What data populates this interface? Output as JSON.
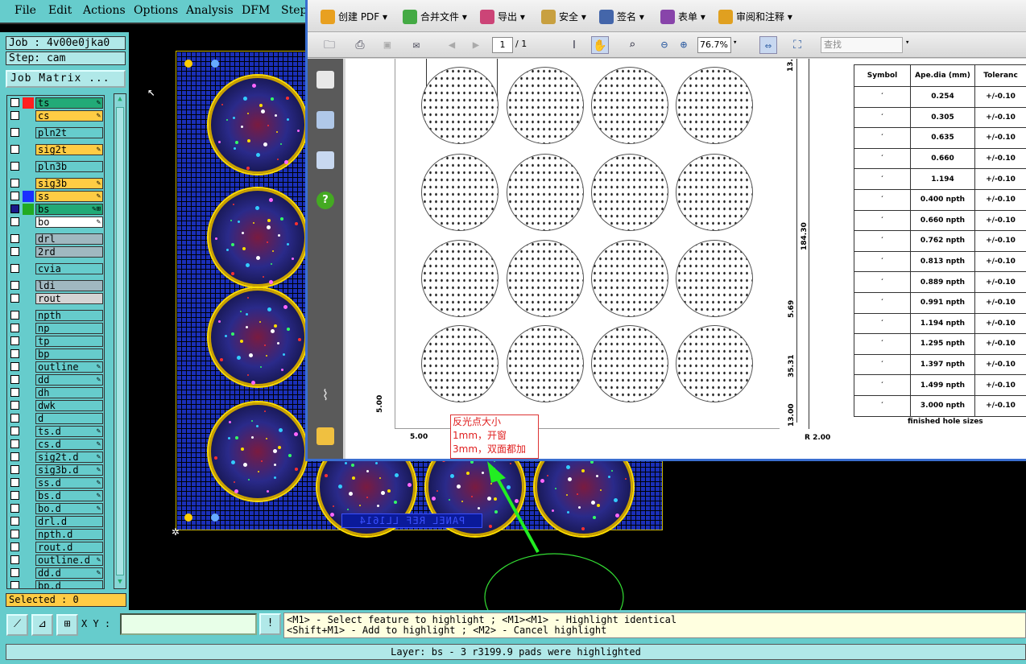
{
  "cam": {
    "menu": [
      "File",
      "Edit",
      "Actions",
      "Options",
      "Analysis",
      "DFM",
      "Step"
    ],
    "job_label": "Job : 4v00e0jka0",
    "step_label": "Step: cam",
    "job_matrix_label": "Job Matrix ...",
    "layers": [
      {
        "name": "ts",
        "color": "#ff2020",
        "bg": "#22aa77",
        "flag": "✎"
      },
      {
        "name": "cs",
        "color": "",
        "bg": "#ffcc44",
        "flag": "✎"
      },
      {
        "name": "pln2t",
        "color": "",
        "bg": "#66cccc",
        "flag": ""
      },
      {
        "name": "sig2t",
        "color": "",
        "bg": "#ffcc44",
        "flag": "✎"
      },
      {
        "name": "pln3b",
        "color": "",
        "bg": "#66cccc",
        "flag": ""
      },
      {
        "name": "sig3b",
        "color": "",
        "bg": "#ffcc44",
        "flag": "✎"
      },
      {
        "name": "ss",
        "color": "#1a30ff",
        "bg": "#ffcc44",
        "flag": "✎"
      },
      {
        "name": "bs",
        "color": "#22aa22",
        "bg": "#22aa77",
        "flag": "✎⊞"
      },
      {
        "name": "bo",
        "color": "",
        "bg": "#ffffff",
        "flag": "✎"
      },
      {
        "name": "drl",
        "color": "",
        "bg": "#a0b8c0",
        "flag": ""
      },
      {
        "name": "2rd",
        "color": "",
        "bg": "#a0b8c0",
        "flag": ""
      },
      {
        "name": "cvia",
        "color": "",
        "bg": "#66cccc",
        "flag": ""
      },
      {
        "name": "ldi",
        "color": "",
        "bg": "#a0b8c0",
        "flag": ""
      },
      {
        "name": "rout",
        "color": "",
        "bg": "#d4d4d4",
        "flag": ""
      },
      {
        "name": "npth",
        "color": "",
        "bg": "#66cccc",
        "flag": ""
      },
      {
        "name": "np",
        "color": "",
        "bg": "#66cccc",
        "flag": ""
      },
      {
        "name": "tp",
        "color": "",
        "bg": "#66cccc",
        "flag": ""
      },
      {
        "name": "bp",
        "color": "",
        "bg": "#66cccc",
        "flag": ""
      },
      {
        "name": "outline",
        "color": "",
        "bg": "#66cccc",
        "flag": "✎"
      },
      {
        "name": "dd",
        "color": "",
        "bg": "#66cccc",
        "flag": "✎"
      },
      {
        "name": "dh",
        "color": "",
        "bg": "#66cccc",
        "flag": ""
      },
      {
        "name": "dwk",
        "color": "",
        "bg": "#66cccc",
        "flag": ""
      },
      {
        "name": "d",
        "color": "",
        "bg": "#66cccc",
        "flag": ""
      },
      {
        "name": "ts.d",
        "color": "",
        "bg": "#66cccc",
        "flag": "✎"
      },
      {
        "name": "cs.d",
        "color": "",
        "bg": "#66cccc",
        "flag": "✎"
      },
      {
        "name": "sig2t.d",
        "color": "",
        "bg": "#66cccc",
        "flag": "✎"
      },
      {
        "name": "sig3b.d",
        "color": "",
        "bg": "#66cccc",
        "flag": "✎"
      },
      {
        "name": "ss.d",
        "color": "",
        "bg": "#66cccc",
        "flag": "✎"
      },
      {
        "name": "bs.d",
        "color": "",
        "bg": "#66cccc",
        "flag": "✎"
      },
      {
        "name": "bo.d",
        "color": "",
        "bg": "#66cccc",
        "flag": "✎"
      },
      {
        "name": "drl.d",
        "color": "",
        "bg": "#66cccc",
        "flag": ""
      },
      {
        "name": "npth.d",
        "color": "",
        "bg": "#66cccc",
        "flag": ""
      },
      {
        "name": "rout.d",
        "color": "",
        "bg": "#66cccc",
        "flag": ""
      },
      {
        "name": "outline.d",
        "color": "",
        "bg": "#66cccc",
        "flag": "✎"
      },
      {
        "name": "dd.d",
        "color": "",
        "bg": "#66cccc",
        "flag": "✎"
      },
      {
        "name": "bp.d",
        "color": "",
        "bg": "#66cccc",
        "flag": ""
      }
    ],
    "selected_label": "Selected : 0",
    "panel_ref": "PANEL REF LL1614",
    "xy_label": "X Y :",
    "xy_value": "",
    "info_btn": "!",
    "hint_line1": "<M1> - Select feature to highlight ; <M1><M1> - Highlight identical",
    "hint_line2": "<Shift+M1> - Add to highlight ; <M2> - Cancel highlight",
    "status": "Layer: bs - 3 r3199.9 pads were highlighted"
  },
  "pdf": {
    "toolbar": [
      {
        "label": "创建 PDF ▾",
        "icon": "create-pdf-icon",
        "color": "#e8a020"
      },
      {
        "label": "合并文件 ▾",
        "icon": "combine-files-icon",
        "color": "#44aa44"
      },
      {
        "label": "导出 ▾",
        "icon": "export-icon",
        "color": "#cc4477"
      },
      {
        "label": "安全 ▾",
        "icon": "security-lock-icon",
        "color": "#c8a040"
      },
      {
        "label": "签名 ▾",
        "icon": "sign-pen-icon",
        "color": "#4466aa"
      },
      {
        "label": "表单 ▾",
        "icon": "forms-icon",
        "color": "#8844aa"
      },
      {
        "label": "审阅和注释 ▾",
        "icon": "review-comment-icon",
        "color": "#e0a020"
      }
    ],
    "page_current": "1",
    "page_total": "/ 1",
    "zoom": "76.7%",
    "find_placeholder": "查找",
    "table": {
      "headers": [
        "Symbol",
        "Ape.dia (mm)",
        "Toleranc"
      ],
      "rows": [
        [
          "0.254",
          "+/-0.10"
        ],
        [
          "0.305",
          "+/-0.10"
        ],
        [
          "0.635",
          "+/-0.10"
        ],
        [
          "0.660",
          "+/-0.10"
        ],
        [
          "1.194",
          "+/-0.10"
        ],
        [
          "0.400 npth",
          "+/-0.10"
        ],
        [
          "0.660 npth",
          "+/-0.10"
        ],
        [
          "0.762 npth",
          "+/-0.10"
        ],
        [
          "0.813 npth",
          "+/-0.10"
        ],
        [
          "0.889 npth",
          "+/-0.10"
        ],
        [
          "0.991 npth",
          "+/-0.10"
        ],
        [
          "1.194 npth",
          "+/-0.10"
        ],
        [
          "1.295 npth",
          "+/-0.10"
        ],
        [
          "1.397 npth",
          "+/-0.10"
        ],
        [
          "1.499 npth",
          "+/-0.10"
        ],
        [
          "3.000 npth",
          "+/-0.10"
        ]
      ],
      "caption": "finished hole sizes"
    },
    "dims": {
      "d_13_top": "13.",
      "d_184": "184.30",
      "d_569": "5.69",
      "d_3531": "35.31",
      "d_1300": "13.00",
      "d_r200": "R 2.00",
      "d_500v": "5.00",
      "d_500h": "5.00"
    },
    "note_lines": [
      "反光点大小",
      "1mm，开窗",
      "3mm，双面都加"
    ]
  },
  "colors": {
    "cam_bg": "#66cccc",
    "board_blue": "#1a2fb8",
    "annotation_green": "#22ee22",
    "note_red": "#e02020"
  }
}
